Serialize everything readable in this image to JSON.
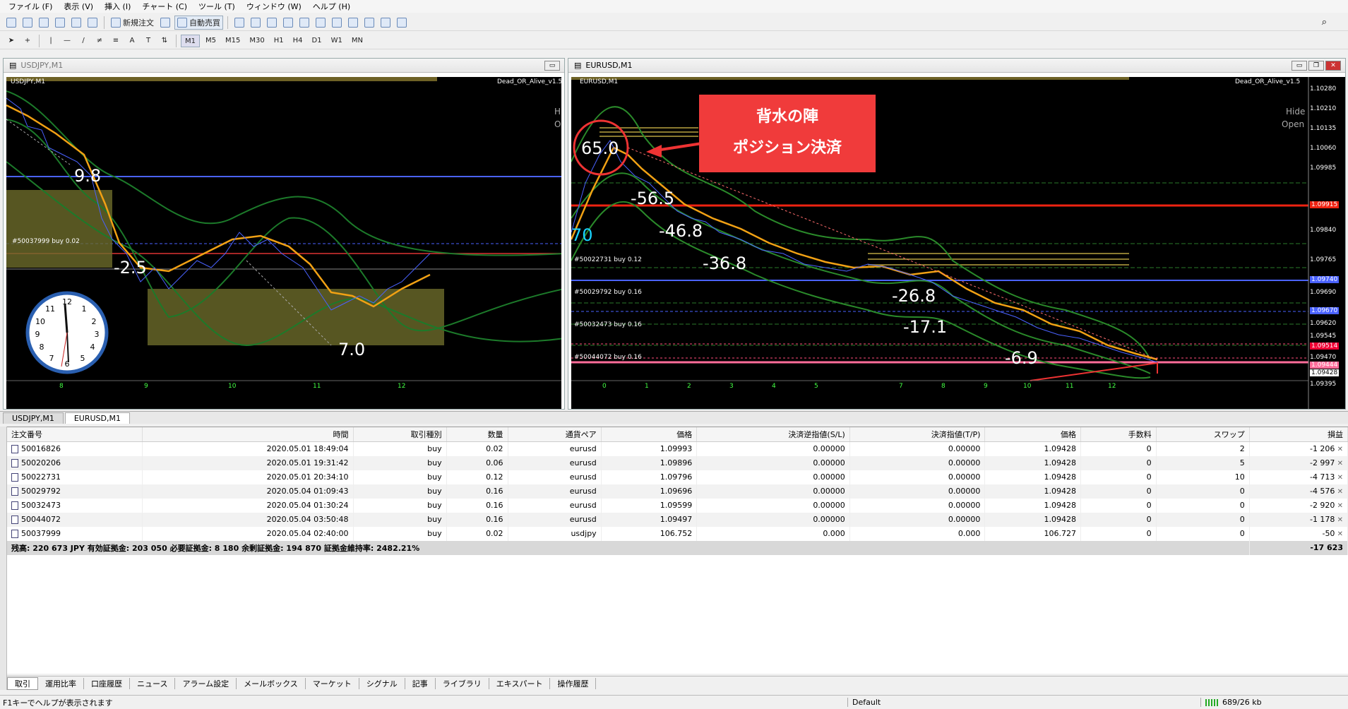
{
  "menu": [
    "ファイル (F)",
    "表示 (V)",
    "挿入 (I)",
    "チャート (C)",
    "ツール (T)",
    "ウィンドウ (W)",
    "ヘルプ (H)"
  ],
  "toolbar": {
    "new_order": "新規注文",
    "auto_trade": "自動売買",
    "timeframes": [
      "M1",
      "M5",
      "M15",
      "M30",
      "H1",
      "H4",
      "D1",
      "W1",
      "MN"
    ]
  },
  "left_chart": {
    "window_title": "USDJPY,M1",
    "symbol_label": "USDJPY,M1",
    "indicator": "Dead_OR_Alive_v1.5",
    "labels": [
      "9.8",
      "-2.5",
      "7.0"
    ],
    "order_label": "#50037999 buy 0.02",
    "xticks": [
      "8",
      "9",
      "10",
      "11",
      "12"
    ],
    "side_text": [
      "Hid",
      "Op"
    ]
  },
  "right_chart": {
    "window_title": "EURUSD,M1",
    "symbol_label": "EURUSD,M1",
    "indicator": "Dead_OR_Alive_v1.5",
    "labels": [
      "65.0",
      "-56.5",
      "-46.8",
      "-36.8",
      "-26.8",
      "-17.1",
      "-6.9"
    ],
    "orders": [
      "#50022731 buy 0.12",
      "#50029792 buy 0.16",
      "#50032473 buy 0.16",
      "#50044072 buy 0.16"
    ],
    "xticks": [
      "0",
      "1",
      "2",
      "3",
      "4",
      "5",
      "7",
      "8",
      "9",
      "10",
      "11",
      "12"
    ],
    "prices": [
      "1.10280",
      "1.10210",
      "1.10135",
      "1.10060",
      "1.09985",
      "1.09915",
      "1.09840",
      "1.09765",
      "1.09740",
      "1.09690",
      "1.09670",
      "1.09620",
      "1.09545",
      "1.09514",
      "1.09470",
      "1.09444",
      "1.09428",
      "1.09395"
    ],
    "side_text": [
      "Hide",
      "Open"
    ],
    "blue_text": "70"
  },
  "callout": {
    "line1": "背水の陣",
    "line2": "ポジション決済"
  },
  "chart_tabs": [
    "USDJPY,M1",
    "EURUSD,M1"
  ],
  "columns": [
    "注文番号",
    "時間",
    "取引種別",
    "数量",
    "通貨ペア",
    "価格",
    "決済逆指値(S/L)",
    "決済指値(T/P)",
    "価格",
    "手数料",
    "スワップ",
    "損益"
  ],
  "orders": [
    [
      "50016826",
      "2020.05.01 18:49:04",
      "buy",
      "0.02",
      "eurusd",
      "1.09993",
      "0.00000",
      "0.00000",
      "1.09428",
      "0",
      "2",
      "-1 206"
    ],
    [
      "50020206",
      "2020.05.01 19:31:42",
      "buy",
      "0.06",
      "eurusd",
      "1.09896",
      "0.00000",
      "0.00000",
      "1.09428",
      "0",
      "5",
      "-2 997"
    ],
    [
      "50022731",
      "2020.05.01 20:34:10",
      "buy",
      "0.12",
      "eurusd",
      "1.09796",
      "0.00000",
      "0.00000",
      "1.09428",
      "0",
      "10",
      "-4 713"
    ],
    [
      "50029792",
      "2020.05.04 01:09:43",
      "buy",
      "0.16",
      "eurusd",
      "1.09696",
      "0.00000",
      "0.00000",
      "1.09428",
      "0",
      "0",
      "-4 576"
    ],
    [
      "50032473",
      "2020.05.04 01:30:24",
      "buy",
      "0.16",
      "eurusd",
      "1.09599",
      "0.00000",
      "0.00000",
      "1.09428",
      "0",
      "0",
      "-2 920"
    ],
    [
      "50044072",
      "2020.05.04 03:50:48",
      "buy",
      "0.16",
      "eurusd",
      "1.09497",
      "0.00000",
      "0.00000",
      "1.09428",
      "0",
      "0",
      "-1 178"
    ],
    [
      "50037999",
      "2020.05.04 02:40:00",
      "buy",
      "0.02",
      "usdjpy",
      "106.752",
      "0.000",
      "0.000",
      "106.727",
      "0",
      "0",
      "-50"
    ]
  ],
  "summary": {
    "text": "残高: 220 673 JPY  有効証拠金: 203 050  必要証拠金: 8 180  余剰証拠金: 194 870  証拠金維持率: 2482.21%",
    "total": "-17 623"
  },
  "bottom_tabs": [
    "取引",
    "運用比率",
    "口座履歴",
    "ニュース",
    "アラーム設定",
    "メールボックス",
    "マーケット",
    "シグナル",
    "記事",
    "ライブラリ",
    "エキスパート",
    "操作履歴"
  ],
  "status": {
    "help": "F1キーでヘルプが表示されます",
    "profile": "Default",
    "traffic": "689/26 kb"
  }
}
